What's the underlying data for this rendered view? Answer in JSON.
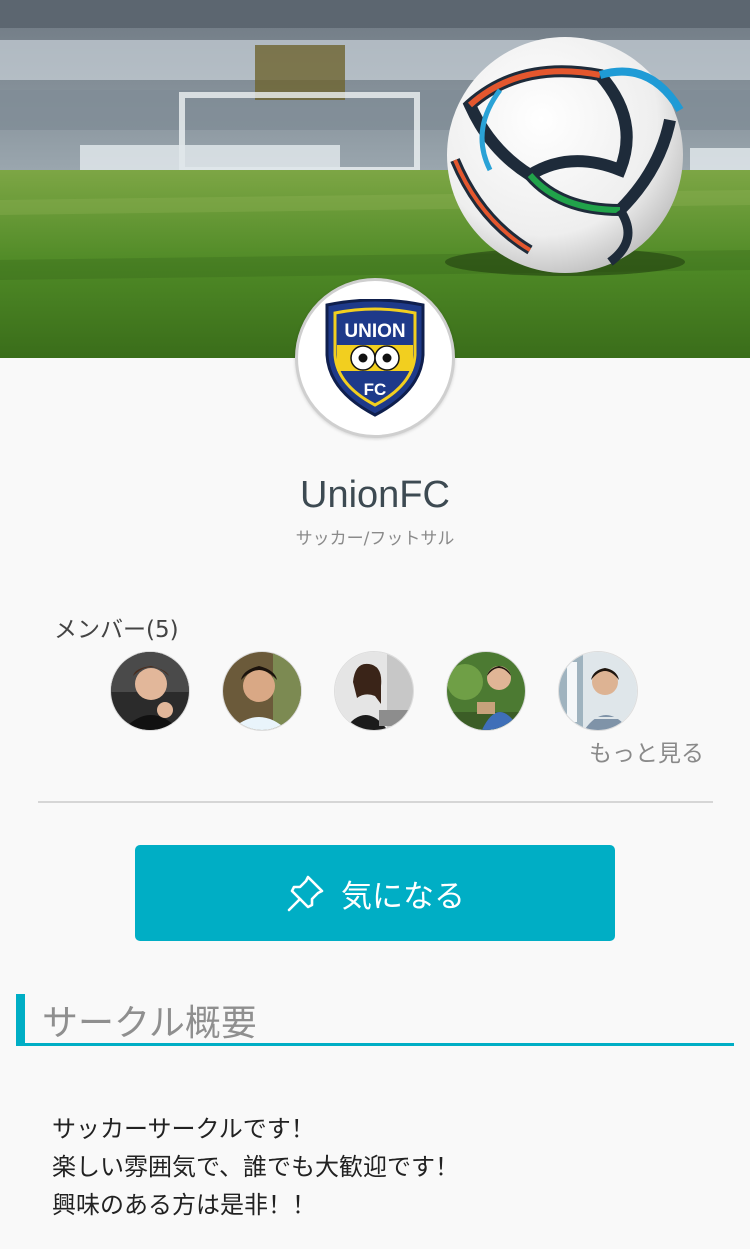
{
  "circle": {
    "name": "UnionFC",
    "category": "サッカー/フットサル"
  },
  "logo": {
    "icon": "union-fc-crest",
    "top_text": "UNION",
    "bottom_text": "FC",
    "colors": {
      "shield": "#1e3a8a",
      "band": "#f2cf1f"
    }
  },
  "members": {
    "label": "メンバー(5)",
    "more_label": "もっと見る",
    "avatars": [
      {
        "name": "member-1"
      },
      {
        "name": "member-2"
      },
      {
        "name": "member-3"
      },
      {
        "name": "member-4"
      },
      {
        "name": "member-5"
      }
    ]
  },
  "interest_button": {
    "label": "気になる",
    "icon": "pin-icon",
    "color": "#00aec5"
  },
  "overview": {
    "heading": "サークル概要",
    "lines": [
      "サッカーサークルです！",
      "楽しい雰囲気で、誰でも大歓迎です！",
      "興味のある方は是非！！"
    ]
  }
}
